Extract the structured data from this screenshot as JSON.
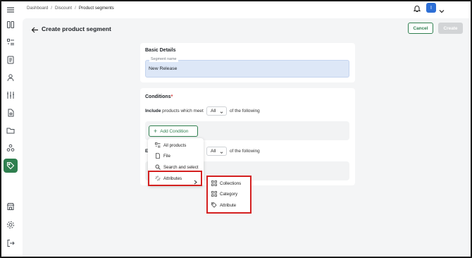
{
  "breadcrumb": [
    "Dashboard",
    "Discount",
    "Product segments"
  ],
  "page": {
    "title": "Create product segment",
    "cancel_label": "Cancel",
    "create_label": "Create"
  },
  "user": {
    "initial": "I"
  },
  "basic_details": {
    "title": "Basic Details",
    "segment_name_label": "Segment name",
    "segment_name_value": "New Release"
  },
  "conditions": {
    "title": "Conditions",
    "required_mark": "*",
    "include_prefix": "Include",
    "include_text": "products which meet",
    "include_select": "All",
    "suffix": "of the following",
    "exclude_prefix": "Ex",
    "exclude_select": "All",
    "add_condition_label": "Add Condition"
  },
  "menu": {
    "items": [
      "All products",
      "File",
      "Search and select",
      "Attributes"
    ]
  },
  "submenu": {
    "items": [
      "Collections",
      "Category",
      "Attribute"
    ]
  },
  "sidebar": {
    "icons": [
      "menu-icon",
      "dashboard-icon",
      "list-icon",
      "document-icon",
      "user-icon",
      "sliders-icon",
      "file-icon",
      "folder-icon",
      "network-icon",
      "tag-icon",
      "store-icon",
      "settings-icon",
      "logout-icon"
    ],
    "active": "tag-icon"
  },
  "colors": {
    "accent": "#2f7f4f",
    "highlight": "#d42020",
    "avatar": "#2d6fd6",
    "field_bg": "#dde7f7"
  }
}
